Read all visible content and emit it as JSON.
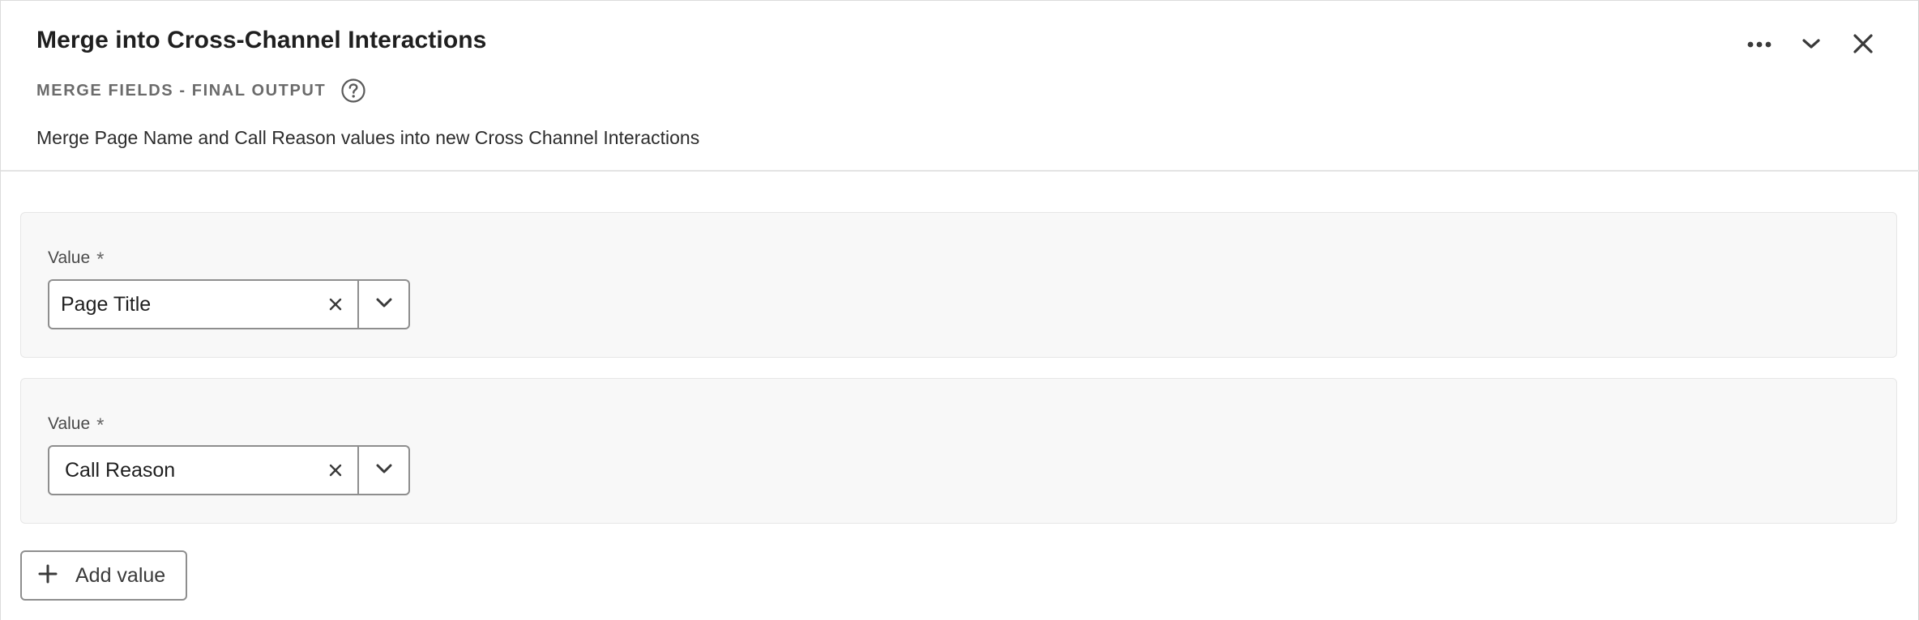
{
  "panel": {
    "title": "Merge into Cross-Channel Interactions",
    "subtitle": "MERGE FIELDS - FINAL OUTPUT",
    "description": "Merge Page Name and Call Reason values into new Cross Channel Interactions",
    "actions": {
      "more_icon": "more-horizontal-icon",
      "collapse_icon": "chevron-down-icon",
      "close_icon": "close-icon"
    },
    "help_icon": "question-circle-icon"
  },
  "fields": [
    {
      "label": "Value",
      "required_mark": "*",
      "value": "Page Title"
    },
    {
      "label": "Value",
      "required_mark": "*",
      "value": "Call Reason"
    }
  ],
  "add_button": {
    "label": "Add value",
    "icon": "plus-icon"
  }
}
